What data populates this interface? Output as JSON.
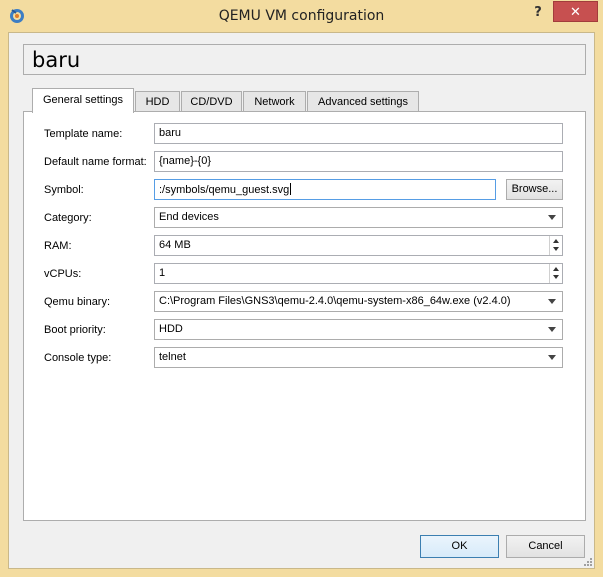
{
  "window": {
    "title": "QEMU VM configuration",
    "help_label": "?",
    "close_label": "✕"
  },
  "name_header": "baru",
  "tabs": [
    {
      "label": "General settings",
      "active": true
    },
    {
      "label": "HDD"
    },
    {
      "label": "CD/DVD"
    },
    {
      "label": "Network"
    },
    {
      "label": "Advanced settings"
    }
  ],
  "form": {
    "template_name": {
      "label": "Template name:",
      "value": "baru"
    },
    "default_name_format": {
      "label": "Default name format:",
      "value": "{name}-{0}"
    },
    "symbol": {
      "label": "Symbol:",
      "value": ":/symbols/qemu_guest.svg",
      "browse_label": "Browse..."
    },
    "category": {
      "label": "Category:",
      "value": "End devices"
    },
    "ram": {
      "label": "RAM:",
      "value": "64 MB"
    },
    "vcpus": {
      "label": "vCPUs:",
      "value": "1"
    },
    "qemu_binary": {
      "label": "Qemu binary:",
      "value": "C:\\Program Files\\GNS3\\qemu-2.4.0\\qemu-system-x86_64w.exe (v2.4.0)"
    },
    "boot_priority": {
      "label": "Boot priority:",
      "value": "HDD"
    },
    "console_type": {
      "label": "Console type:",
      "value": "telnet"
    }
  },
  "buttons": {
    "ok": "OK",
    "cancel": "Cancel"
  },
  "colors": {
    "title_bar": "#f3dca0",
    "close_button": "#c75050",
    "focus_border": "#569de5"
  }
}
